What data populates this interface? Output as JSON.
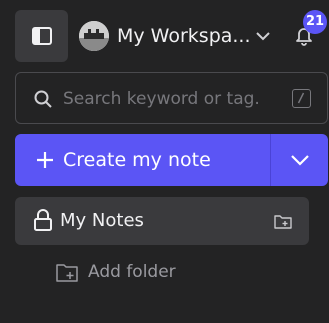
{
  "header": {
    "sidebar_toggle_icon": "sidebar-panel-icon",
    "workspace_name": "My Workspa...",
    "workspace_chevron_icon": "chevron-down-icon",
    "notification_icon": "bell-icon",
    "notification_count": "21"
  },
  "search": {
    "placeholder": "Search keyword or tag.",
    "value": "",
    "shortcut_key": "/"
  },
  "create": {
    "label": "Create my note",
    "icon": "plus-icon",
    "dropdown_icon": "chevron-down-icon"
  },
  "sidebar": {
    "items": [
      {
        "label": "My Notes",
        "icon": "lock-icon",
        "action_icon": "add-folder-icon"
      }
    ],
    "add_folder_label": "Add folder"
  },
  "colors": {
    "background": "#232324",
    "accent": "#5b55f5",
    "panel": "#3a3a3d",
    "muted_text": "#9a9aa0"
  }
}
